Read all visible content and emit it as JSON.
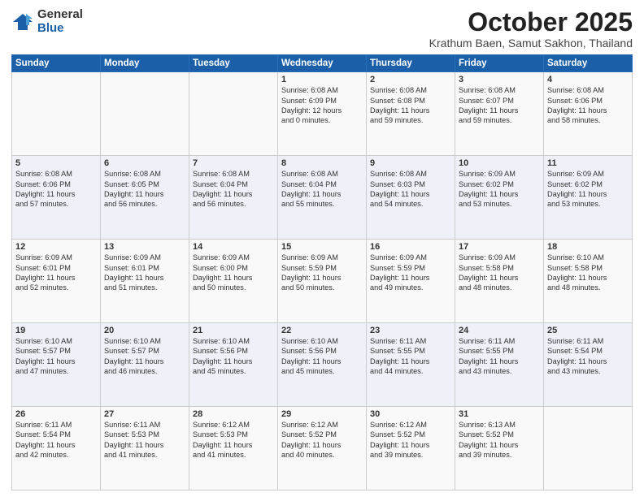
{
  "header": {
    "logo_general": "General",
    "logo_blue": "Blue",
    "month": "October 2025",
    "location": "Krathum Baen, Samut Sakhon, Thailand"
  },
  "weekdays": [
    "Sunday",
    "Monday",
    "Tuesday",
    "Wednesday",
    "Thursday",
    "Friday",
    "Saturday"
  ],
  "weeks": [
    [
      {
        "day": "",
        "text": ""
      },
      {
        "day": "",
        "text": ""
      },
      {
        "day": "",
        "text": ""
      },
      {
        "day": "1",
        "text": "Sunrise: 6:08 AM\nSunset: 6:09 PM\nDaylight: 12 hours\nand 0 minutes."
      },
      {
        "day": "2",
        "text": "Sunrise: 6:08 AM\nSunset: 6:08 PM\nDaylight: 11 hours\nand 59 minutes."
      },
      {
        "day": "3",
        "text": "Sunrise: 6:08 AM\nSunset: 6:07 PM\nDaylight: 11 hours\nand 59 minutes."
      },
      {
        "day": "4",
        "text": "Sunrise: 6:08 AM\nSunset: 6:06 PM\nDaylight: 11 hours\nand 58 minutes."
      }
    ],
    [
      {
        "day": "5",
        "text": "Sunrise: 6:08 AM\nSunset: 6:06 PM\nDaylight: 11 hours\nand 57 minutes."
      },
      {
        "day": "6",
        "text": "Sunrise: 6:08 AM\nSunset: 6:05 PM\nDaylight: 11 hours\nand 56 minutes."
      },
      {
        "day": "7",
        "text": "Sunrise: 6:08 AM\nSunset: 6:04 PM\nDaylight: 11 hours\nand 56 minutes."
      },
      {
        "day": "8",
        "text": "Sunrise: 6:08 AM\nSunset: 6:04 PM\nDaylight: 11 hours\nand 55 minutes."
      },
      {
        "day": "9",
        "text": "Sunrise: 6:08 AM\nSunset: 6:03 PM\nDaylight: 11 hours\nand 54 minutes."
      },
      {
        "day": "10",
        "text": "Sunrise: 6:09 AM\nSunset: 6:02 PM\nDaylight: 11 hours\nand 53 minutes."
      },
      {
        "day": "11",
        "text": "Sunrise: 6:09 AM\nSunset: 6:02 PM\nDaylight: 11 hours\nand 53 minutes."
      }
    ],
    [
      {
        "day": "12",
        "text": "Sunrise: 6:09 AM\nSunset: 6:01 PM\nDaylight: 11 hours\nand 52 minutes."
      },
      {
        "day": "13",
        "text": "Sunrise: 6:09 AM\nSunset: 6:01 PM\nDaylight: 11 hours\nand 51 minutes."
      },
      {
        "day": "14",
        "text": "Sunrise: 6:09 AM\nSunset: 6:00 PM\nDaylight: 11 hours\nand 50 minutes."
      },
      {
        "day": "15",
        "text": "Sunrise: 6:09 AM\nSunset: 5:59 PM\nDaylight: 11 hours\nand 50 minutes."
      },
      {
        "day": "16",
        "text": "Sunrise: 6:09 AM\nSunset: 5:59 PM\nDaylight: 11 hours\nand 49 minutes."
      },
      {
        "day": "17",
        "text": "Sunrise: 6:09 AM\nSunset: 5:58 PM\nDaylight: 11 hours\nand 48 minutes."
      },
      {
        "day": "18",
        "text": "Sunrise: 6:10 AM\nSunset: 5:58 PM\nDaylight: 11 hours\nand 48 minutes."
      }
    ],
    [
      {
        "day": "19",
        "text": "Sunrise: 6:10 AM\nSunset: 5:57 PM\nDaylight: 11 hours\nand 47 minutes."
      },
      {
        "day": "20",
        "text": "Sunrise: 6:10 AM\nSunset: 5:57 PM\nDaylight: 11 hours\nand 46 minutes."
      },
      {
        "day": "21",
        "text": "Sunrise: 6:10 AM\nSunset: 5:56 PM\nDaylight: 11 hours\nand 45 minutes."
      },
      {
        "day": "22",
        "text": "Sunrise: 6:10 AM\nSunset: 5:56 PM\nDaylight: 11 hours\nand 45 minutes."
      },
      {
        "day": "23",
        "text": "Sunrise: 6:11 AM\nSunset: 5:55 PM\nDaylight: 11 hours\nand 44 minutes."
      },
      {
        "day": "24",
        "text": "Sunrise: 6:11 AM\nSunset: 5:55 PM\nDaylight: 11 hours\nand 43 minutes."
      },
      {
        "day": "25",
        "text": "Sunrise: 6:11 AM\nSunset: 5:54 PM\nDaylight: 11 hours\nand 43 minutes."
      }
    ],
    [
      {
        "day": "26",
        "text": "Sunrise: 6:11 AM\nSunset: 5:54 PM\nDaylight: 11 hours\nand 42 minutes."
      },
      {
        "day": "27",
        "text": "Sunrise: 6:11 AM\nSunset: 5:53 PM\nDaylight: 11 hours\nand 41 minutes."
      },
      {
        "day": "28",
        "text": "Sunrise: 6:12 AM\nSunset: 5:53 PM\nDaylight: 11 hours\nand 41 minutes."
      },
      {
        "day": "29",
        "text": "Sunrise: 6:12 AM\nSunset: 5:52 PM\nDaylight: 11 hours\nand 40 minutes."
      },
      {
        "day": "30",
        "text": "Sunrise: 6:12 AM\nSunset: 5:52 PM\nDaylight: 11 hours\nand 39 minutes."
      },
      {
        "day": "31",
        "text": "Sunrise: 6:13 AM\nSunset: 5:52 PM\nDaylight: 11 hours\nand 39 minutes."
      },
      {
        "day": "",
        "text": ""
      }
    ]
  ]
}
